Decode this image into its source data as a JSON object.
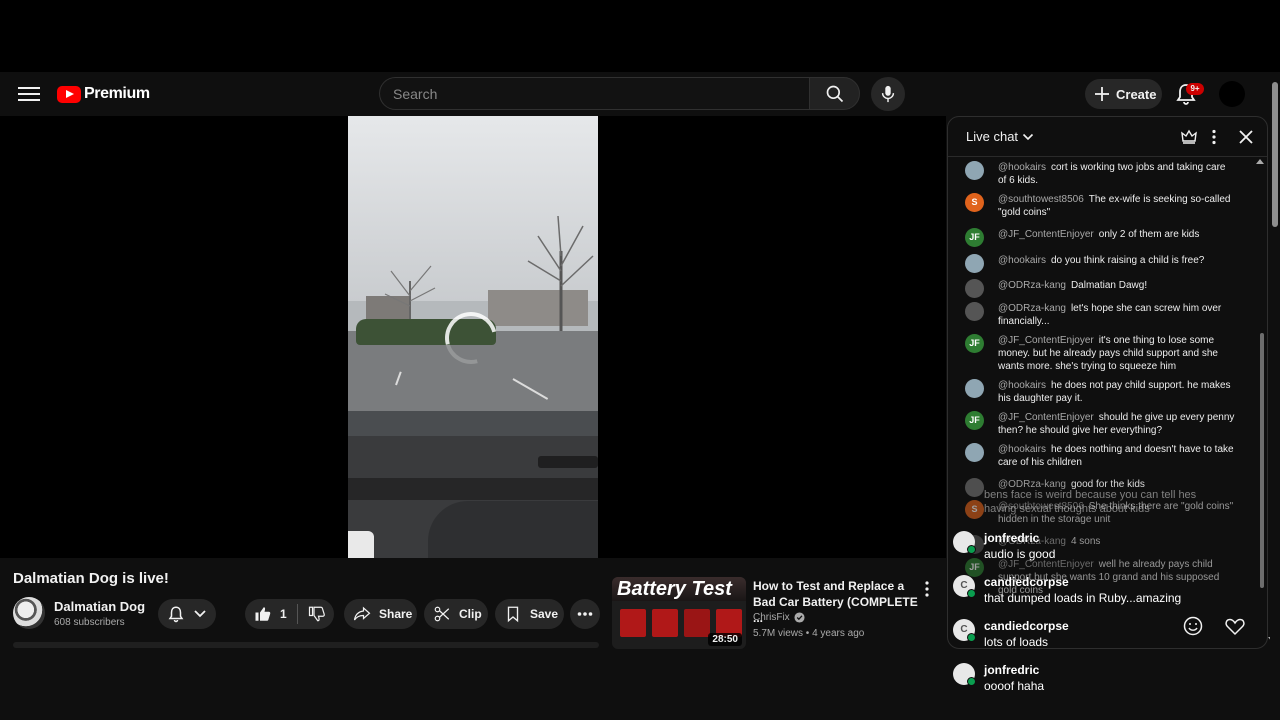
{
  "masthead": {
    "logo_text": "Premium",
    "search_placeholder": "Search",
    "create_label": "Create",
    "notification_count": "9+"
  },
  "video": {
    "title": "Dalmatian Dog is live!",
    "channel_name": "Dalmatian Dog",
    "subscribers": "608 subscribers",
    "like_count": "1",
    "share_label": "Share",
    "clip_label": "Clip",
    "save_label": "Save"
  },
  "recommended": {
    "thumb_text": "Battery Test",
    "duration": "28:50",
    "title": "How to Test and Replace a Bad Car Battery (COMPLETE ...",
    "channel": "ChrisFix",
    "meta": "5.7M views • 4 years ago"
  },
  "chat": {
    "title": "Live chat",
    "messages": [
      {
        "author": "@hookairs",
        "text": "cort is working two jobs and taking care of 6 kids.",
        "avatar": "",
        "color": "#8fa6b3"
      },
      {
        "author": "@southtowest8506",
        "text": "The ex-wife is seeking so-called \"gold coins\"",
        "avatar": "S",
        "color": "#e0631c"
      },
      {
        "author": "@JF_ContentEnjoyer",
        "text": "only 2 of them are kids",
        "avatar": "JF",
        "color": "#2e7d32"
      },
      {
        "author": "@hookairs",
        "text": "do you think raising a child is free?",
        "avatar": "",
        "color": "#8fa6b3"
      },
      {
        "author": "@ODRza-kang",
        "text": "Dalmatian Dawg!",
        "avatar": "",
        "color": "#555555"
      },
      {
        "author": "@ODRza-kang",
        "text": "let's hope she can screw him over financially...",
        "avatar": "",
        "color": "#555555"
      },
      {
        "author": "@JF_ContentEnjoyer",
        "text": "it's one thing to lose some money. but he already pays child support and she wants more. she's trying to squeeze him",
        "avatar": "JF",
        "color": "#2e7d32"
      },
      {
        "author": "@hookairs",
        "text": "he does not pay child support. he makes his daughter pay it.",
        "avatar": "",
        "color": "#8fa6b3"
      },
      {
        "author": "@JF_ContentEnjoyer",
        "text": "should he give up every penny then? he should give her everything?",
        "avatar": "JF",
        "color": "#2e7d32"
      },
      {
        "author": "@hookairs",
        "text": "he does nothing and doesn't have to take care of his children",
        "avatar": "",
        "color": "#8fa6b3"
      },
      {
        "author": "@ODRza-kang",
        "text": "good for the kids",
        "avatar": "",
        "color": "#555555"
      },
      {
        "author": "@southtowest8506",
        "text": "She thinks there are \"gold coins\" hidden in the storage unit",
        "avatar": "S",
        "color": "#e0631c"
      },
      {
        "author": "@ODRza-kang",
        "text": "4 sons",
        "avatar": "",
        "color": "#555555"
      },
      {
        "author": "@JF_ContentEnjoyer",
        "text": "well he already pays child support but she wants 10 grand and his supposed gold coins",
        "avatar": "JF",
        "color": "#2e7d32"
      }
    ],
    "ghost_lines": [
      "bens face is weird because you can tell hes",
      "having sexual thoughts about kids"
    ],
    "overlay": [
      {
        "name": "jonfredric",
        "text": "audio is good",
        "avatar": ""
      },
      {
        "name": "candiedcorpse",
        "text": "that dumped loads in Ruby...amazing",
        "avatar": "C"
      },
      {
        "name": "candiedcorpse",
        "text": "lots of loads",
        "avatar": "C"
      },
      {
        "name": "jonfredric",
        "text": "oooof haha",
        "avatar": ""
      }
    ]
  }
}
